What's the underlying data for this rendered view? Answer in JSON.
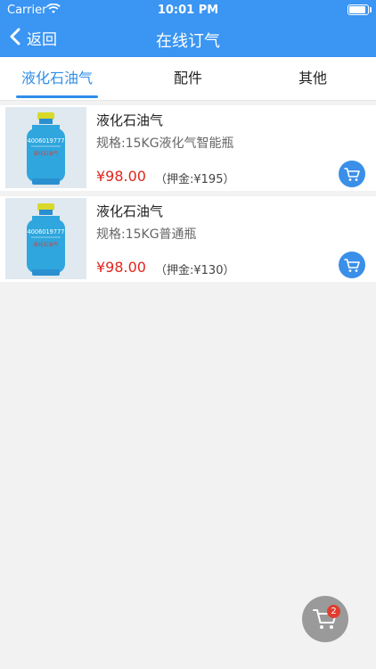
{
  "status_bar": {
    "carrier": "Carrier",
    "time": "10:01 PM"
  },
  "nav": {
    "back_label": "返回",
    "title": "在线订气"
  },
  "tabs": [
    {
      "label": "液化石油气",
      "active": true
    },
    {
      "label": "配件",
      "active": false
    },
    {
      "label": "其他",
      "active": false
    }
  ],
  "products": [
    {
      "name": "液化石油气",
      "spec": "规格:15KG液化气智能瓶",
      "price": "¥98.00",
      "deposit": "（押金:¥195）",
      "cylinder_phone": "4006019777",
      "cylinder_label": "液化石油气"
    },
    {
      "name": "液化石油气",
      "spec": "规格:15KG普通瓶",
      "price": "¥98.00",
      "deposit": "（押金:¥130）",
      "cylinder_phone": "4006019777",
      "cylinder_label": "液化石油气"
    }
  ],
  "cart": {
    "count": "2"
  },
  "colors": {
    "accent": "#3a95f3",
    "price": "#e0271f",
    "tab_active": "#2f8ee8"
  },
  "icons": [
    "wifi-icon",
    "battery-icon",
    "back-chevron-icon",
    "cart-icon"
  ]
}
